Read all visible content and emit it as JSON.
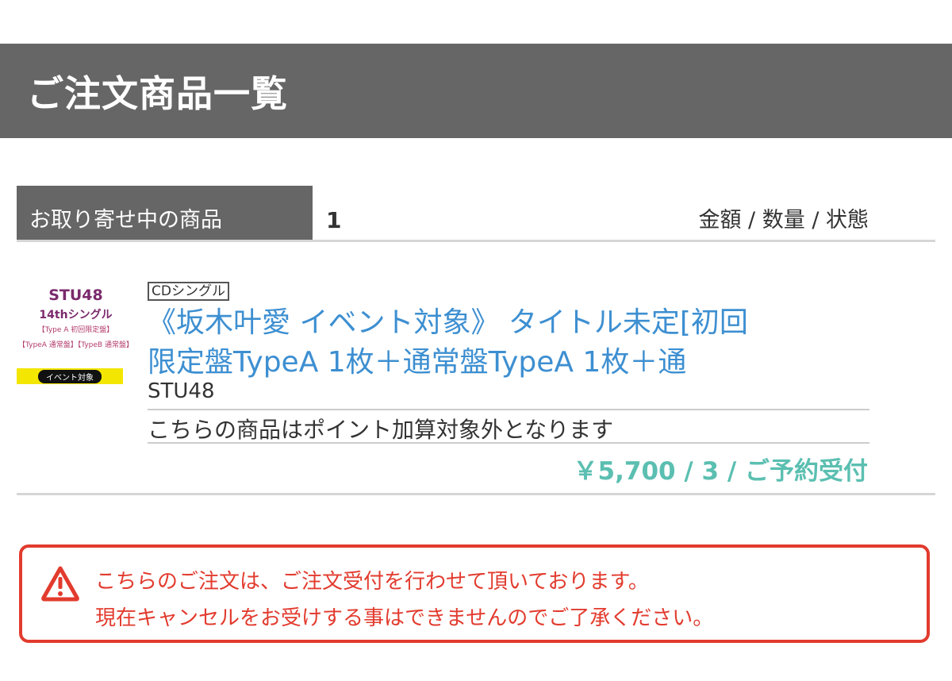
{
  "header": {
    "title": "ご注文商品一覧"
  },
  "section": {
    "tab_label": "お取り寄せ中の商品",
    "count": "1",
    "columns_label": "金額 / 数量 / 状態"
  },
  "item": {
    "thumbnail": {
      "line1": "STU48",
      "line2": "14thシングル",
      "line3": "【Type A 初回限定盤】",
      "line4": "【TypeA 通常盤】【TypeB 通常盤】",
      "badge": "イベント対象"
    },
    "category": "CDシングル",
    "title_line1": "《坂木叶愛 イベント対象》 タイトル未定[初回",
    "title_line2": "限定盤TypeA 1枚＋通常盤TypeA 1枚＋通",
    "artist": "STU48",
    "point_note": "こちらの商品はポイント加算対象外となります",
    "price_qty_status": "￥5,700 / 3 / ご予約受付"
  },
  "warning": {
    "icon": "warning-triangle-icon",
    "line1": "こちらのご注文は、ご注文受付を行わせて頂いております。",
    "line2": "現在キャンセルをお受けする事はできませんのでご了承ください。"
  },
  "colors": {
    "header_bg": "#666666",
    "link_blue": "#3d8fd1",
    "price_teal": "#5bbfb1",
    "warning_red": "#e23b2e"
  }
}
